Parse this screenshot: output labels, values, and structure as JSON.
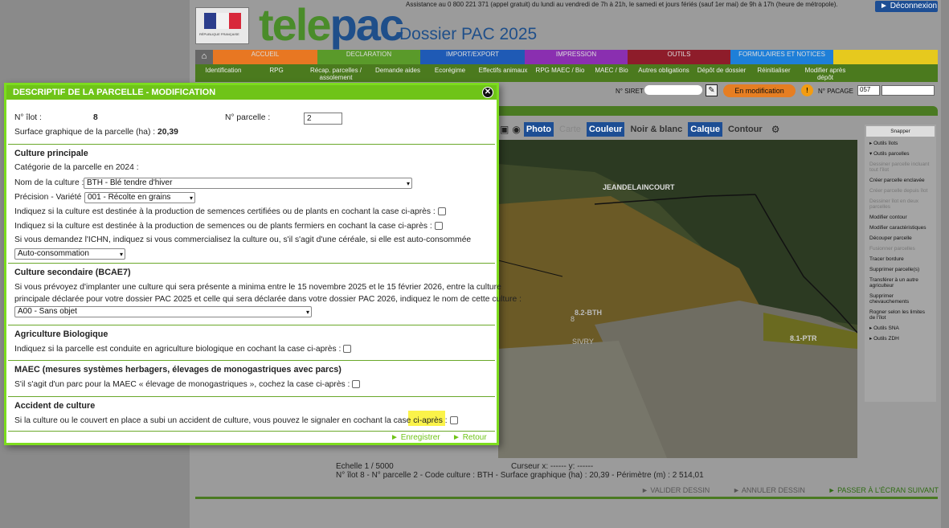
{
  "header": {
    "assistance": "Assistance au 0 800 221 371 (appel gratuit) du lundi au vendredi de 7h à 21h, le samedi et jours fériés (sauf 1er mai) de 9h à 17h (heure de métropole).",
    "logout": "Déconnexion",
    "logo_tele": "tele",
    "logo_pac": "pac",
    "dossier": "Dossier PAC 2025",
    "republique": "RÉPUBLIQUE FRANÇAISE",
    "colors": {
      "green": "#4a8c2a",
      "blue": "#1f4f8a"
    }
  },
  "nav": {
    "tabs": [
      {
        "label": "ACCUEIL",
        "color": "#e87722"
      },
      {
        "label": "DECLARATION",
        "color": "#5a9a2a"
      },
      {
        "label": "IMPORT/EXPORT",
        "color": "#1f5ab5"
      },
      {
        "label": "IMPRESSION",
        "color": "#8a2fb0"
      },
      {
        "label": "OUTILS",
        "color": "#8e1c2a"
      },
      {
        "label": "FORMULAIRES ET NOTICES",
        "color": "#1e7fd8"
      },
      {
        "label": "",
        "color": "#e6c91e"
      }
    ],
    "sub": [
      "Identification",
      "RPG",
      "Récap. parcelles / assolement",
      "Demande aides",
      "Ecorégime",
      "Effectifs animaux",
      "RPG MAEC / Bio",
      "MAEC / Bio",
      "Autres obligations",
      "Dépôt de dossier",
      "Réinitialiser",
      "Modifier après dépôt"
    ]
  },
  "siret": {
    "label": "N° SIRET",
    "status": "En modification",
    "pacage_label": "N° PACAGE",
    "pacage_value": "057"
  },
  "map": {
    "tools": [
      "Photo",
      "Carte",
      "Couleur",
      "Noir & blanc",
      "Calque",
      "Contour"
    ],
    "labels": [
      "JEANDELAINCOURT",
      "8.2-BTH",
      "8",
      "SIVRY",
      "8.1-PTR"
    ],
    "scale": "Echelle 1 / 5000",
    "cursor": "Curseur x: ------ y: ------",
    "info": "N° îlot 8 - N° parcelle 2 - Code culture : BTH - Surface graphique (ha) : 20,39 - Périmètre (m) : 2 514,01",
    "valider": "VALIDER DESSIN",
    "annuler": "ANNULER DESSIN",
    "suivant": "PASSER À L'ÉCRAN SUIVANT"
  },
  "side": [
    "Snapper",
    "▸ Outils îlots",
    "▾ Outils parcelles",
    "Dessiner parcelle incluant tout l'îlot",
    "Créer parcelle enclavée",
    "Créer parcelle depuis îlot",
    "Dessiner îlot en deux parcelles",
    "Modifier contour",
    "Modifier caractéristiques",
    "Découper parcelle",
    "Fusionner parcelles",
    "Tracer bordure",
    "Supprimer parcelle(s)",
    "Transférer à un autre agriculteur",
    "Supprimer chevauchements",
    "Rogner selon les limites de l'îlot",
    "▸ Outils SNA",
    "▸ Outils ZDH"
  ],
  "dialog": {
    "title": "DESCRIPTIF DE LA PARCELLE - MODIFICATION",
    "ilot_label": "N° îlot :",
    "ilot_value": "8",
    "parcelle_label": "N° parcelle :",
    "parcelle_value": "2",
    "surface_label": "Surface graphique de la parcelle (ha) :",
    "surface_value": "20,39",
    "s1_title": "Culture principale",
    "categorie": "Catégorie de la parcelle en 2024 :",
    "nom_label": "Nom de la culture :",
    "nom_value": "BTH - Blé tendre d'hiver",
    "precision_label": "Précision - Variété :",
    "precision_value": "001 - Récolte en grains",
    "semences_cert": "Indiquez si la culture est destinée à la production de semences certifiées ou de plants en cochant la case ci-après :",
    "semences_ferm": "Indiquez si la culture est destinée à la production de semences ou de plants fermiers en cochant la case ci-après :",
    "ichn": "Si vous demandez l'ICHN, indiquez si vous commercialisez la culture ou, s'il s'agit d'une céréale, si elle est auto-consommée",
    "ichn_value": "Auto-consommation",
    "s2_title": "Culture secondaire (BCAE7)",
    "s2_text1": "Si vous prévoyez d'implanter une culture qui sera présente a minima entre le 15 novembre 2025 et le 15 février 2026, entre la culture",
    "s2_text2": "principale déclarée pour votre dossier PAC 2025 et celle qui sera déclarée dans votre dossier PAC 2026, indiquez le nom de cette culture :",
    "s2_value": "A00 - Sans objet",
    "s3_title": "Agriculture Biologique",
    "s3_text": "Indiquez si la parcelle est conduite en agriculture biologique en cochant la case ci-après :",
    "s4_title": "MAEC (mesures systèmes herbagers, élevages de monogastriques avec parcs)",
    "s4_text": "S'il s'agit d'un parc pour la MAEC « élevage de monogastriques », cochez la case ci-après :",
    "s5_title": "Accident de culture",
    "s5_text": "Si la culture ou le couvert en place a subi un accident de culture, vous pouvez le signaler en cochant la case ci-après :",
    "enregistrer": "Enregistrer",
    "retour": "Retour"
  }
}
